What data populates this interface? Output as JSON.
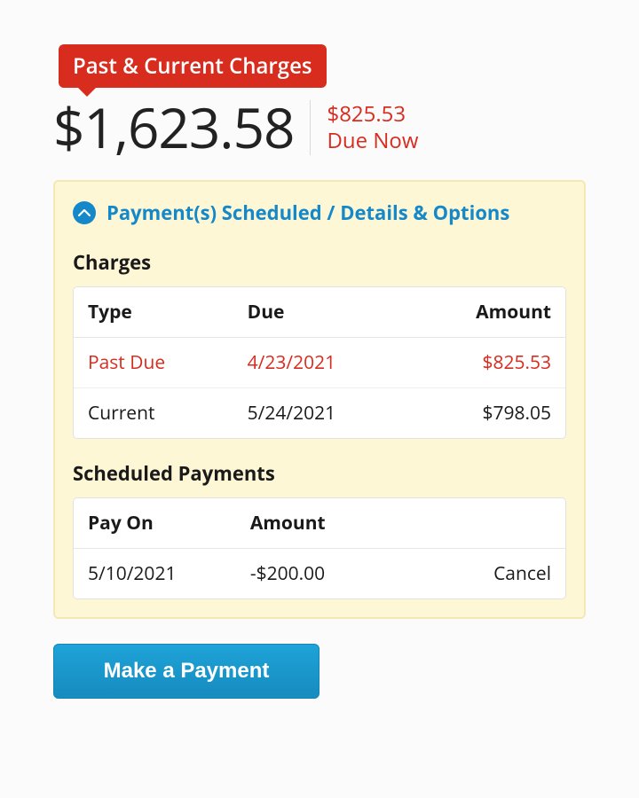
{
  "badge_label": "Past & Current Charges",
  "total_amount": "$1,623.58",
  "due_now_amount": "$825.53",
  "due_now_label": "Due Now",
  "panel_title": "Payment(s) Scheduled / Details & Options",
  "charges": {
    "title": "Charges",
    "headers": {
      "type": "Type",
      "due": "Due",
      "amount": "Amount"
    },
    "rows": [
      {
        "type": "Past Due",
        "due": "4/23/2021",
        "amount": "$825.53",
        "past_due": true
      },
      {
        "type": "Current",
        "due": "5/24/2021",
        "amount": "$798.05",
        "past_due": false
      }
    ]
  },
  "scheduled_payments": {
    "title": "Scheduled Payments",
    "headers": {
      "pay_on": "Pay On",
      "amount": "Amount"
    },
    "rows": [
      {
        "pay_on": "5/10/2021",
        "amount": "-$200.00",
        "action": "Cancel"
      }
    ]
  },
  "make_payment_label": "Make a Payment"
}
